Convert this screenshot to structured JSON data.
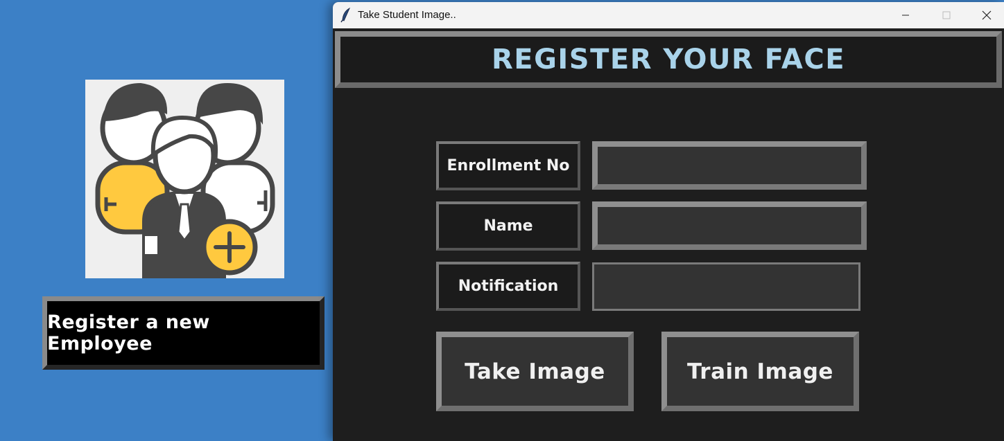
{
  "background_app": {
    "register_button_label": "Register a new Employee",
    "avatar_icon": "add-users-icon",
    "colors": {
      "background": "#3c80c6",
      "button_bg": "#000000",
      "avatar_yellow": "#ffc93f",
      "avatar_dark": "#474747"
    }
  },
  "window": {
    "title": "Take Student Image..",
    "app_icon": "feather-icon",
    "header_title": "REGISTER YOUR FACE",
    "labels": {
      "enrollment": "Enrollment No",
      "name": "Name",
      "notification": "Notification"
    },
    "inputs": {
      "enrollment_value": "",
      "name_value": ""
    },
    "notification_text": "",
    "buttons": {
      "take_image": "Take Image",
      "train_image": "Train Image"
    },
    "colors": {
      "window_bg": "#1e1e1e",
      "title_text": "#a9d3ea",
      "field_bg": "#333333"
    }
  }
}
